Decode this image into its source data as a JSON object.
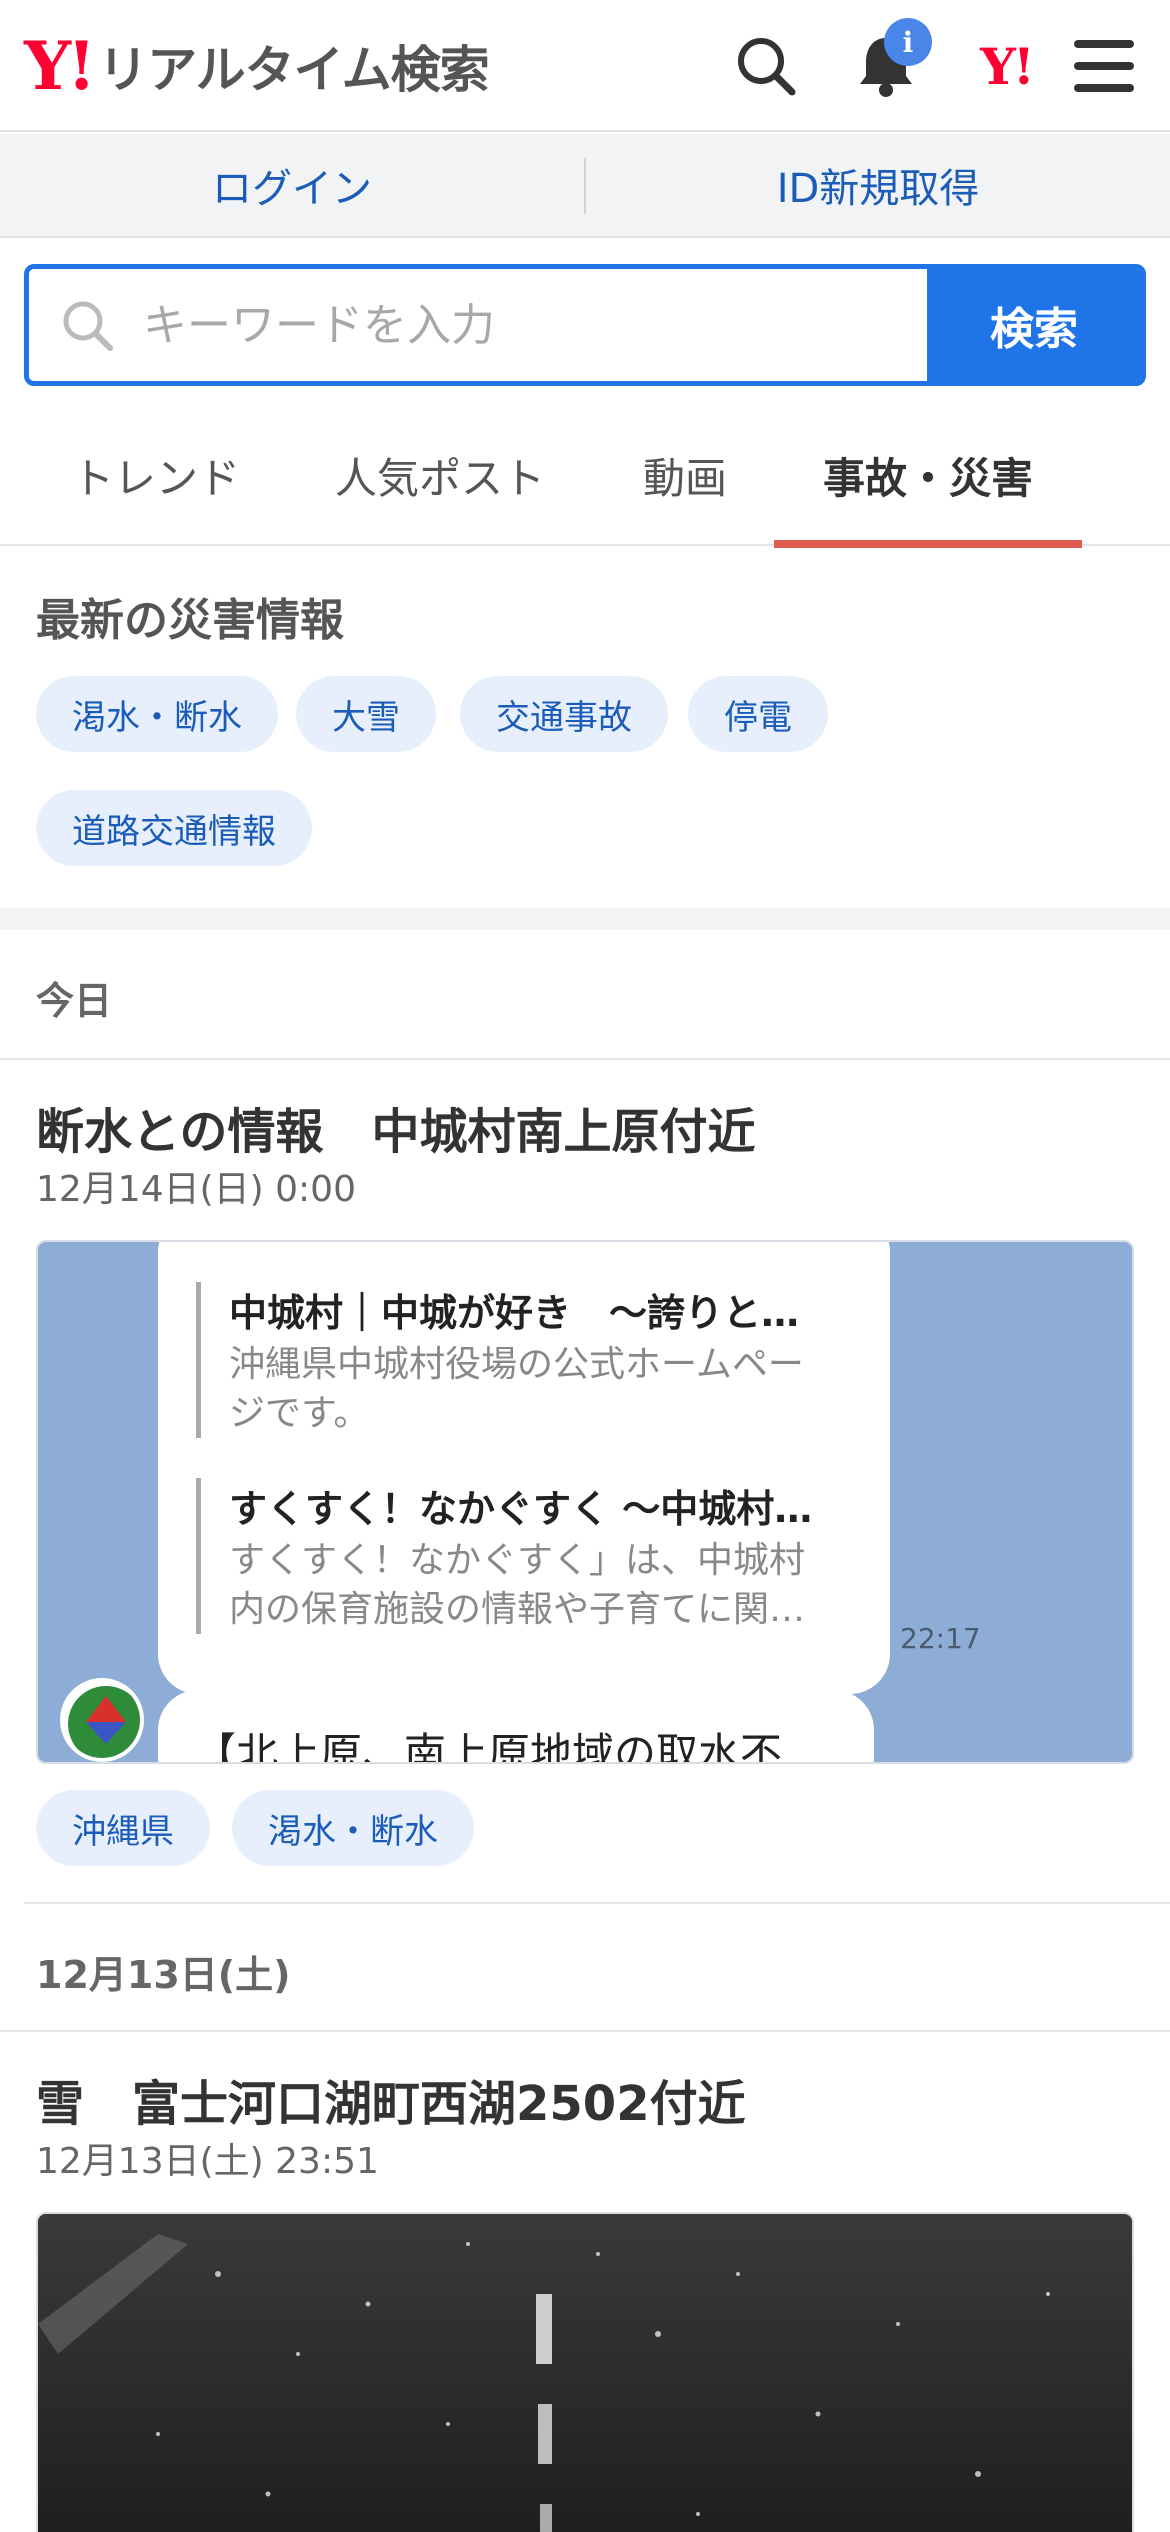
{
  "header": {
    "logo_mark": "Y!",
    "logo_text": "リアルタイム検索",
    "notification_badge": "i",
    "yahoo_mark": "Y!",
    "icons": [
      "search-icon",
      "bell-icon",
      "yahoo-logo",
      "menu-icon"
    ]
  },
  "login_bar": {
    "login": "ログイン",
    "register": "ID新規取得"
  },
  "search": {
    "placeholder": "キーワードを入力",
    "button": "検索"
  },
  "tabs": [
    {
      "label": "トレンド"
    },
    {
      "label": "人気ポスト"
    },
    {
      "label": "動画"
    },
    {
      "label": "事故・災害",
      "active": true
    }
  ],
  "disaster": {
    "title": "最新の災害情報",
    "chips": [
      "渇水・断水",
      "大雪",
      "交通事故",
      "停電",
      "道路交通情報"
    ]
  },
  "feed": {
    "today_label": "今日",
    "post1": {
      "title": "断水との情報　中城村南上原付近",
      "date": "12月14日(日) 0:00",
      "image": {
        "card1_title": "中城村｜中城が好き　〜誇りと…",
        "card1_desc": "沖縄県中城村役場の公式ホームページです。",
        "card2_title": "すくすく！なかぐすく 〜中城村…",
        "card2_desc": "すくすく！なかぐすく」は、中城村内の保育施設の情報や子育てに関…",
        "time": "22:17",
        "message": "【北上原、南上原地域の取水不"
      },
      "tags": [
        "沖縄県",
        "渇水・断水"
      ]
    },
    "day2_label": "12月13日(土)",
    "post2": {
      "title": "雪　富士河口湖町西湖2502付近",
      "date": "12月13日(土) 23:51"
    }
  },
  "colors": {
    "brand_red": "#ff0033",
    "link_blue": "#1a5cb8",
    "search_blue": "#1f75e8",
    "active_tab_underline": "#e05b4f",
    "chip_bg": "#e6effb"
  }
}
